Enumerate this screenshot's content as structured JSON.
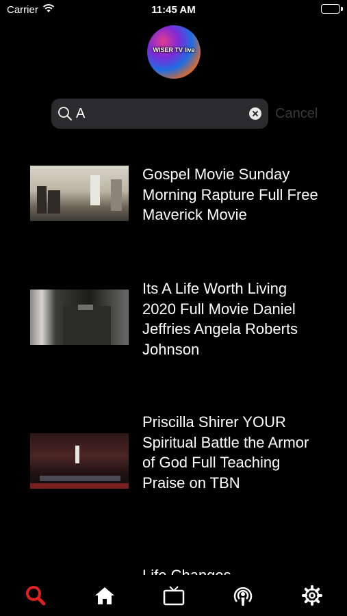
{
  "status_bar": {
    "carrier": "Carrier",
    "time": "11:45 AM"
  },
  "logo": {
    "text": "WISER TV live"
  },
  "search": {
    "value": "A",
    "cancel_label": "Cancel"
  },
  "results": [
    {
      "title": "Gospel Movie Sunday Morning Rapture Full Free Maverick Movie"
    },
    {
      "title": "Its A Life Worth Living 2020 Full Movie Daniel Jeffries Angela Roberts Johnson"
    },
    {
      "title": "Priscilla Shirer YOUR Spiritual Battle the Armor of God Full Teaching Praise on TBN"
    },
    {
      "title": "Life Changes"
    }
  ],
  "tab_bar": {
    "active_tab": "search",
    "active_color": "#e02020",
    "inactive_color": "#ffffff",
    "tabs": [
      {
        "name": "search",
        "icon": "search-icon"
      },
      {
        "name": "home",
        "icon": "home-icon"
      },
      {
        "name": "tv",
        "icon": "tv-icon"
      },
      {
        "name": "podcast",
        "icon": "podcast-icon"
      },
      {
        "name": "settings",
        "icon": "gear-icon"
      }
    ]
  }
}
